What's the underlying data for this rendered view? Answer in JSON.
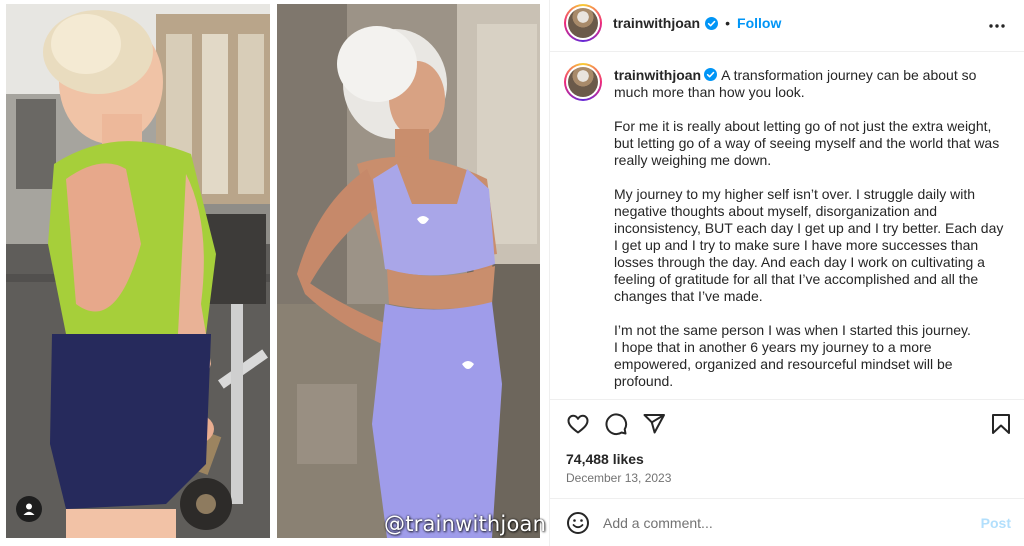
{
  "media": {
    "watermark": "@trainwithjoan",
    "tag_icon": "user-tag-icon"
  },
  "header": {
    "username": "trainwithjoan",
    "separator": "•",
    "follow_label": "Follow",
    "more_icon": "more-horizontal-icon"
  },
  "caption": {
    "username": "trainwithjoan",
    "paragraphs": [
      "A transformation journey can be about so much more than how you look.",
      "For me it is really about letting go of not just the extra weight, but letting go of a way of seeing myself and the world that was really weighing me down.",
      "My journey to my higher self isn’t over. I struggle daily with negative thoughts about myself, disorganization and inconsistency, BUT each day I get up and I try better. Each day I get up and I try to make sure I have more successes than losses through the day. And each day I work on cultivating a feeling of gratitude for all that I’ve accomplished and all the changes that I’ve made.",
      "I’m not the same person I was when I started this journey.\nI hope that in another 6 years my journey to a more empowered, organized and resourceful mindset will be profound."
    ]
  },
  "actions": {
    "like_icon": "heart-icon",
    "comment_icon": "comment-icon",
    "share_icon": "share-icon",
    "save_icon": "bookmark-icon"
  },
  "stats": {
    "likes": "74,488 likes",
    "date": "December 13, 2023"
  },
  "comment": {
    "placeholder": "Add a comment...",
    "post_label": "Post",
    "emoji_icon": "emoji-icon"
  },
  "colors": {
    "accent": "#0095f6",
    "post_disabled": "#b2dffc",
    "text": "#262626",
    "muted": "#737373",
    "divider": "#efefef"
  }
}
